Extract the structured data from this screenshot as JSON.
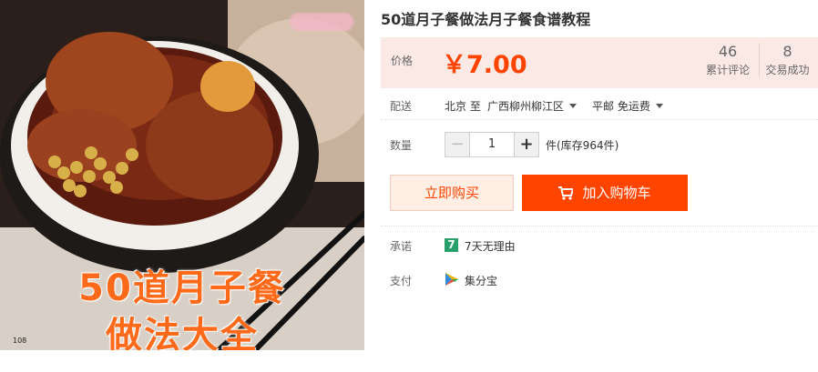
{
  "image": {
    "caption_line1": "50道月子餐",
    "caption_line2": "做法大全",
    "watermark": "108"
  },
  "product": {
    "title": "50道月子餐做法月子餐食谱教程"
  },
  "price": {
    "label": "价格",
    "value": "￥7.00",
    "reviews_count": "46",
    "reviews_label": "累计评论",
    "deals_count": "8",
    "deals_label": "交易成功"
  },
  "shipping": {
    "label": "配送",
    "from": "北京 至",
    "to": "广西柳州柳江区",
    "method": "平邮 免运费"
  },
  "quantity": {
    "label": "数量",
    "minus": "−",
    "value": "1",
    "plus": "+",
    "stock": "件(库存964件)"
  },
  "actions": {
    "buy_now": "立即购买",
    "add_to_cart": "加入购物车"
  },
  "promise": {
    "label": "承诺",
    "badge": "7",
    "text": "7天无理由"
  },
  "payment": {
    "label": "支付",
    "text": "集分宝"
  },
  "colors": {
    "accent": "#ff4400",
    "price_bg": "#fbe9e6",
    "badge_green": "#27a06a"
  }
}
